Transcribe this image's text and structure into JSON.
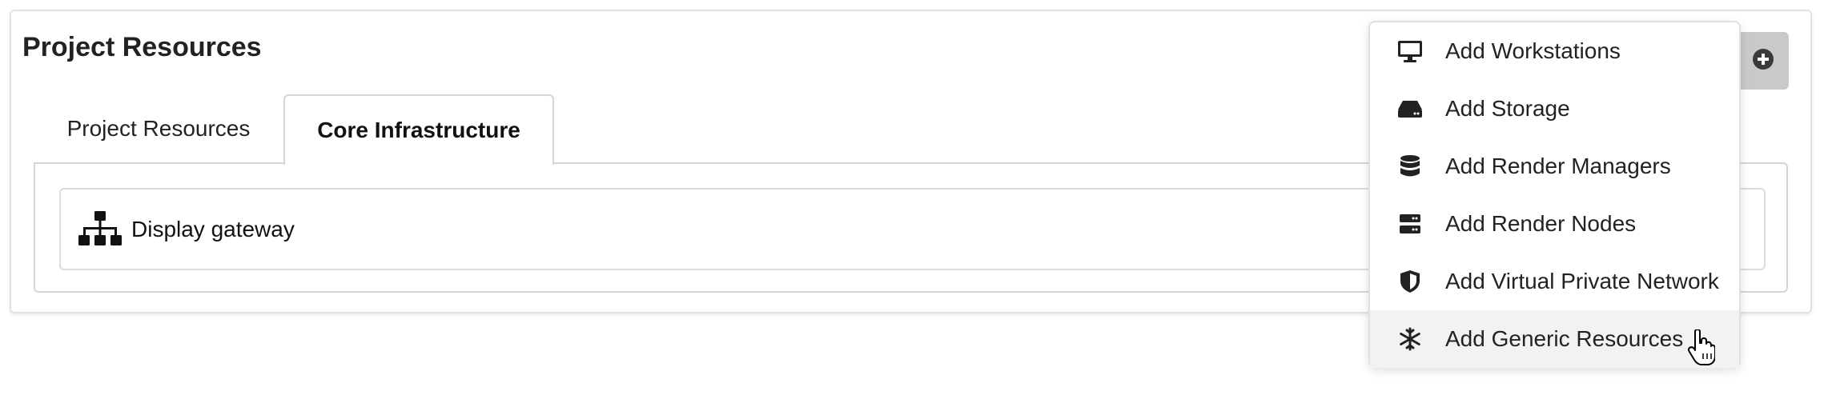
{
  "panel": {
    "title": "Project Resources"
  },
  "tabs": [
    {
      "label": "Project Resources",
      "active": false
    },
    {
      "label": "Core Infrastructure",
      "active": true
    }
  ],
  "resources": [
    {
      "label": "Display gateway",
      "icon": "sitemap-icon"
    }
  ],
  "add_button": {
    "icon": "plus-circle-icon"
  },
  "dropdown": {
    "items": [
      {
        "label": "Add Workstations",
        "icon": "desktop-icon"
      },
      {
        "label": "Add Storage",
        "icon": "hdd-icon"
      },
      {
        "label": "Add Render Managers",
        "icon": "database-icon"
      },
      {
        "label": "Add Render Nodes",
        "icon": "server-icon"
      },
      {
        "label": "Add Virtual Private Network",
        "icon": "shield-icon"
      },
      {
        "label": "Add Generic Resources",
        "icon": "snowflake-icon",
        "hovered": true
      }
    ]
  },
  "colors": {
    "add_button_bg": "#c9c9c9",
    "hover_bg": "#f2f2f2",
    "border": "#d5d5d5"
  }
}
